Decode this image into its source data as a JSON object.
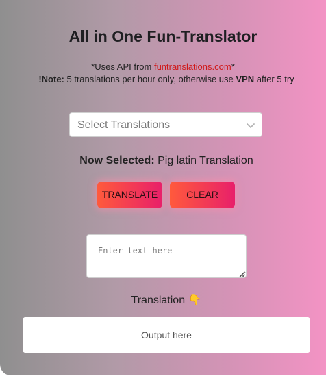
{
  "app": {
    "title": "All in One Fun-Translator"
  },
  "info": {
    "api_prefix": "*Uses API from ",
    "api_link": "funtranslations.com",
    "api_suffix": "*",
    "note_label": "!Note:",
    "note_text_1": " 5 translations per hour only, otherwise use ",
    "note_vpn": "VPN",
    "note_text_2": " after 5 try"
  },
  "select": {
    "value": "Select Translations",
    "icon": "chevron-down-icon"
  },
  "selected": {
    "label": "Now Selected:",
    "value": " Pig latin Translation"
  },
  "buttons": {
    "translate": "TRANSLATE",
    "clear": "CLEAR"
  },
  "input": {
    "placeholder": "Enter text here"
  },
  "output": {
    "label": "Translation",
    "emoji": "👇",
    "placeholder": "Output here"
  },
  "colors": {
    "accent_start": "#ff5a3c",
    "accent_end": "#e8206a",
    "link": "#d01818"
  }
}
